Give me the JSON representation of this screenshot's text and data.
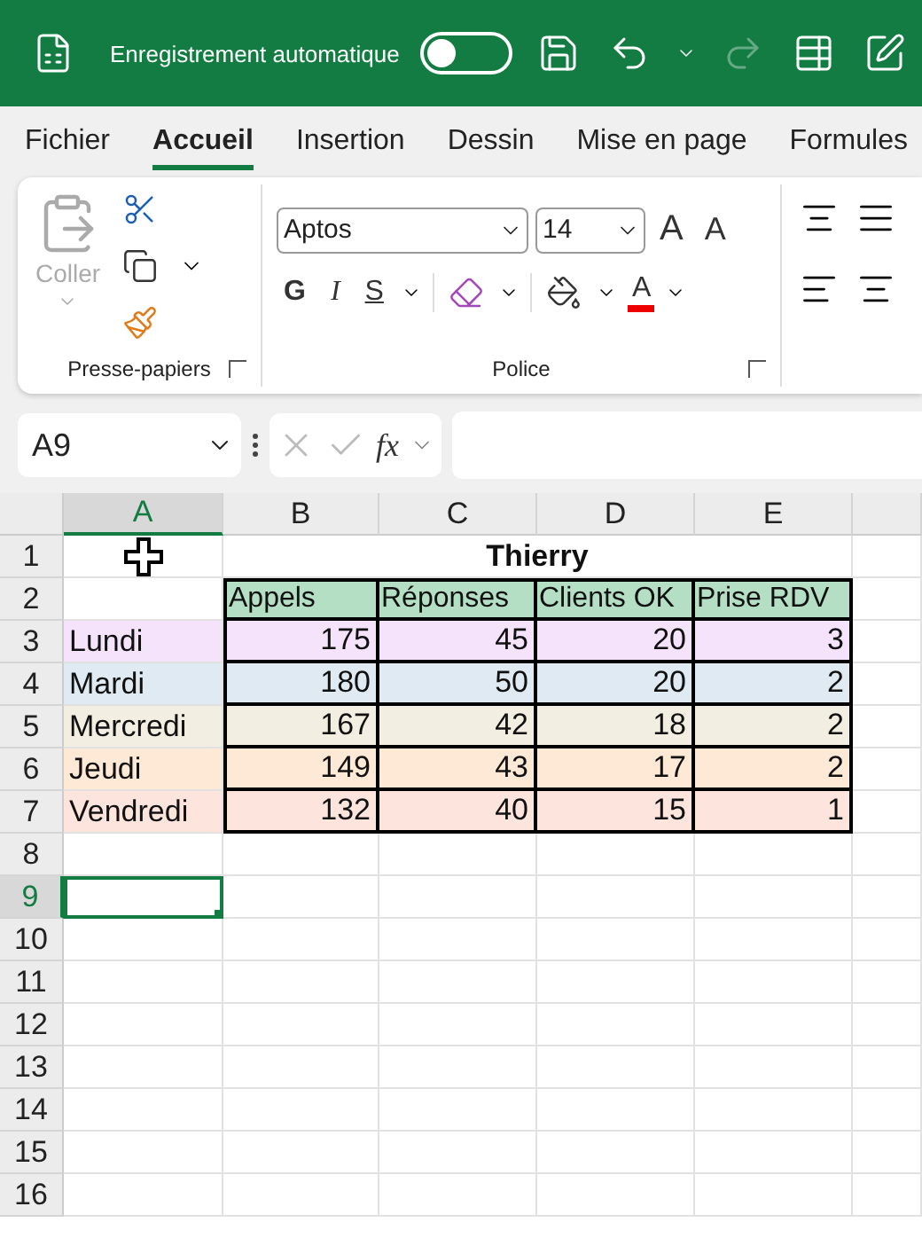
{
  "title_bar": {
    "autosave_label": "Enregistrement automatique",
    "autosave_on": false,
    "redo_disabled": true
  },
  "menu_tabs": [
    {
      "label": "Fichier",
      "selected": false
    },
    {
      "label": "Accueil",
      "selected": true
    },
    {
      "label": "Insertion",
      "selected": false
    },
    {
      "label": "Dessin",
      "selected": false
    },
    {
      "label": "Mise en page",
      "selected": false
    },
    {
      "label": "Formules",
      "selected": false
    }
  ],
  "ribbon": {
    "clipboard": {
      "label": "Presse-papiers",
      "paste_label": "Coller",
      "paste_disabled": true
    },
    "font": {
      "label": "Police",
      "font_name": "Aptos",
      "font_size": "14",
      "grow_label": "A",
      "shrink_label": "A",
      "bold_label": "G",
      "italic_label": "I",
      "underline_label": "S",
      "font_color_label": "A"
    }
  },
  "formula_bar": {
    "name_box": "A9",
    "function_label": "fx"
  },
  "sheet": {
    "columns": [
      {
        "label": "A",
        "selected": true
      },
      {
        "label": "B",
        "selected": false
      },
      {
        "label": "C",
        "selected": false
      },
      {
        "label": "D",
        "selected": false
      },
      {
        "label": "E",
        "selected": false
      }
    ],
    "row_numbers": [
      {
        "label": "1",
        "selected": false
      },
      {
        "label": "2",
        "selected": false
      },
      {
        "label": "3",
        "selected": false
      },
      {
        "label": "4",
        "selected": false
      },
      {
        "label": "5",
        "selected": false
      },
      {
        "label": "6",
        "selected": false
      },
      {
        "label": "7",
        "selected": false
      },
      {
        "label": "8",
        "selected": false
      },
      {
        "label": "9",
        "selected": true
      },
      {
        "label": "10",
        "selected": false
      },
      {
        "label": "11",
        "selected": false
      },
      {
        "label": "12",
        "selected": false
      },
      {
        "label": "13",
        "selected": false
      },
      {
        "label": "14",
        "selected": false
      },
      {
        "label": "15",
        "selected": false
      },
      {
        "label": "16",
        "selected": false
      }
    ],
    "title": "Thierry",
    "headers": [
      "Appels",
      "Réponses",
      "Clients OK",
      "Prise RDV"
    ],
    "data": [
      {
        "label": "Lundi",
        "color": "#f5e3fb",
        "values": [
          "175",
          "45",
          "20",
          "3"
        ]
      },
      {
        "label": "Mardi",
        "color": "#dfeaf3",
        "values": [
          "180",
          "50",
          "20",
          "2"
        ]
      },
      {
        "label": "Mercredi",
        "color": "#f2efe2",
        "values": [
          "167",
          "42",
          "18",
          "2"
        ]
      },
      {
        "label": "Jeudi",
        "color": "#fde9d5",
        "values": [
          "149",
          "43",
          "17",
          "2"
        ]
      },
      {
        "label": "Vendredi",
        "color": "#fde4dd",
        "values": [
          "132",
          "40",
          "15",
          "1"
        ]
      }
    ]
  }
}
